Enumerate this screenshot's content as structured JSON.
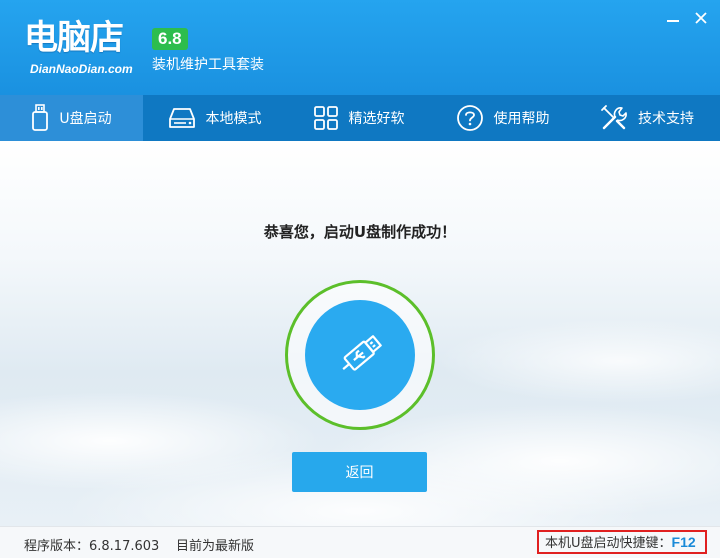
{
  "header": {
    "logo": "电脑店",
    "logo_domain": "DianNaoDian.com",
    "version_badge": "6.8",
    "tagline": "装机维护工具套装"
  },
  "nav": {
    "items": [
      {
        "label": "U盘启动",
        "icon": "usb-drive-icon",
        "active": true
      },
      {
        "label": "本地模式",
        "icon": "hard-drive-icon",
        "active": false
      },
      {
        "label": "精选好软",
        "icon": "app-grid-icon",
        "active": false
      },
      {
        "label": "使用帮助",
        "icon": "help-circle-icon",
        "active": false
      },
      {
        "label": "技术支持",
        "icon": "tools-icon",
        "active": false
      }
    ]
  },
  "main": {
    "message": "恭喜您，启动U盘制作成功！",
    "back_label": "返回"
  },
  "status": {
    "version": "程序版本：6.8.17.603",
    "latest": "目前为最新版",
    "hotkey_label": "本机U盘启动快捷键：",
    "hotkey_value": "F12"
  },
  "colors": {
    "header_blue": "#1a91e0",
    "nav_blue": "#0f78c2",
    "accent_green": "#5cbf2a",
    "button_blue": "#27a8ec",
    "highlight_red": "#e02020"
  }
}
